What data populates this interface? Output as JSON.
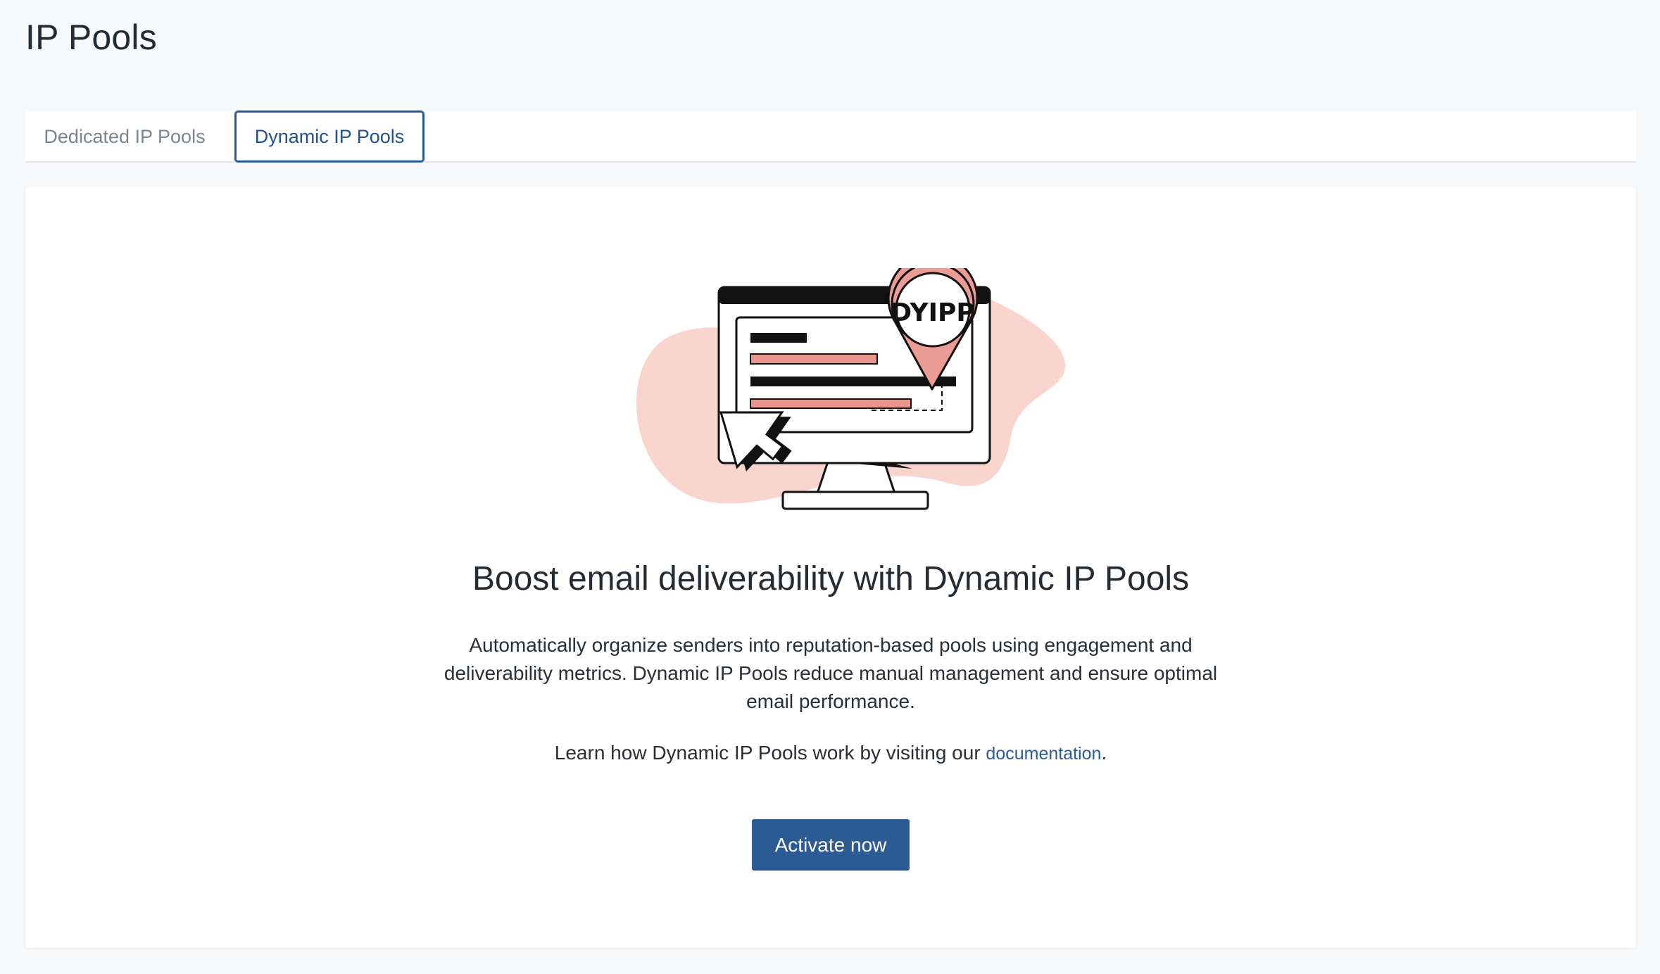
{
  "page": {
    "title": "IP Pools"
  },
  "tabs": [
    {
      "label": "Dedicated IP Pools",
      "active": false
    },
    {
      "label": "Dynamic IP Pools",
      "active": true
    }
  ],
  "empty_state": {
    "illustration_icon": "monitor-location-pin-illustration",
    "pin_text": "DYIPP",
    "headline": "Boost email deliverability with Dynamic IP Pools",
    "description": "Automatically organize senders into reputation-based pools using engagement and deliverability metrics. Dynamic IP Pools reduce manual management and ensure optimal email performance.",
    "learn_prefix": "Learn how Dynamic IP Pools work by visiting our ",
    "learn_link": "documentation",
    "learn_suffix": ".",
    "cta_label": "Activate now"
  },
  "colors": {
    "accent": "#2c5a93",
    "blob": "#f9d5cd",
    "pink_bar": "#e8958d",
    "pin": "#ec9c94",
    "ink": "#111111",
    "background": "#f7f8fa"
  }
}
